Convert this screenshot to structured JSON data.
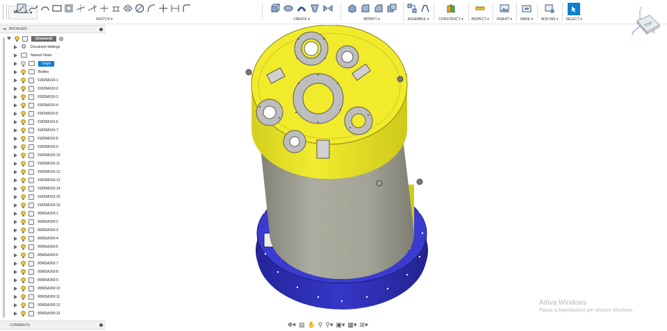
{
  "toolbar": {
    "workspace": "MODEL",
    "groups": [
      {
        "label": "SKETCH"
      },
      {
        "label": "CREATE"
      },
      {
        "label": "MODIFY"
      },
      {
        "label": "ASSEMBLE"
      },
      {
        "label": "CONSTRUCT"
      },
      {
        "label": "INSPECT"
      },
      {
        "label": "INSERT"
      },
      {
        "label": "MAKE"
      },
      {
        "label": "ADD-INS"
      },
      {
        "label": "SELECT"
      }
    ]
  },
  "viewcube": {
    "face": "TOP",
    "axis_x": "X",
    "axis_y": "Y",
    "axis_z": "Z"
  },
  "browser": {
    "title": "BROWSER",
    "root": "(Unsaved)",
    "items": [
      {
        "label": "Document Settings",
        "kind": "settings"
      },
      {
        "label": "Named Views",
        "kind": "folder"
      },
      {
        "label": "Origin",
        "kind": "origin"
      },
      {
        "label": "Bodies",
        "kind": "bodies"
      },
      {
        "label": "91828A316:1"
      },
      {
        "label": "91828A316:2"
      },
      {
        "label": "91828A316:3"
      },
      {
        "label": "91828A316:4"
      },
      {
        "label": "91828A316:5"
      },
      {
        "label": "91828A316:6"
      },
      {
        "label": "91828A316:7"
      },
      {
        "label": "91828A316:8"
      },
      {
        "label": "91828A316:9"
      },
      {
        "label": "91828A316:10"
      },
      {
        "label": "91828A316:11"
      },
      {
        "label": "91828A316:12"
      },
      {
        "label": "91828A316:13"
      },
      {
        "label": "91828A316:14"
      },
      {
        "label": "91828A316:15"
      },
      {
        "label": "91828A316:16"
      },
      {
        "label": "90965A260:1"
      },
      {
        "label": "90965A260:2"
      },
      {
        "label": "90965A260:3"
      },
      {
        "label": "90965A260:4"
      },
      {
        "label": "90965A260:5"
      },
      {
        "label": "90965A260:6"
      },
      {
        "label": "90965A260:7"
      },
      {
        "label": "90965A260:8"
      },
      {
        "label": "90965A260:9"
      },
      {
        "label": "90965A260:10"
      },
      {
        "label": "90965A260:11"
      },
      {
        "label": "90965A260:12"
      },
      {
        "label": "90965A260:13"
      }
    ]
  },
  "comments": {
    "title": "COMMENTS"
  },
  "watermark": {
    "title": "Attiva Windows",
    "subtitle": "Passa a Impostazioni per attivare Windows."
  },
  "colors": {
    "accent": "#0a7ed4",
    "model_yellow": "#f0ea2a",
    "model_blue": "#2f30b8"
  }
}
